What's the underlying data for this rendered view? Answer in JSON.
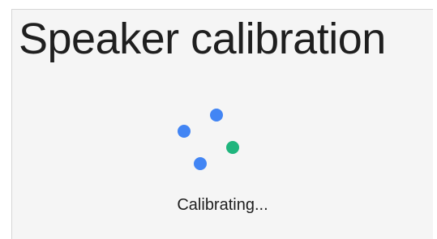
{
  "screen": {
    "title": "Speaker calibration",
    "status_text": "Calibrating..."
  },
  "spinner": {
    "icon": "calibration-progress-dots-icon",
    "dots": [
      {
        "color": "#4285f4"
      },
      {
        "color": "#4285f4"
      },
      {
        "color": "#1fb57d"
      },
      {
        "color": "#4285f4"
      }
    ]
  }
}
